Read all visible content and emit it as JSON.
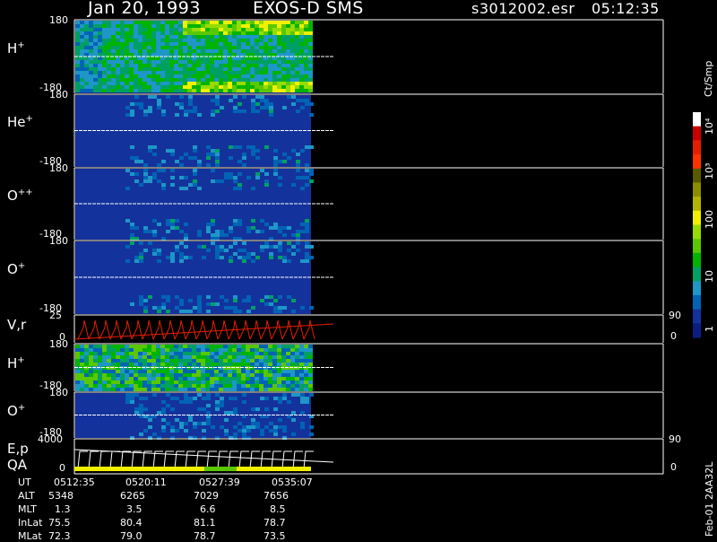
{
  "header": {
    "date": "Jan 20, 1993",
    "instrument": "EXOS-D SMS",
    "file": "s3012002.esr",
    "time": "05:12:35"
  },
  "panels": [
    {
      "id": "h1",
      "label": "H",
      "sup": "+",
      "top": "180",
      "bottom": "-180"
    },
    {
      "id": "he",
      "label": "He",
      "sup": "+",
      "top": "180",
      "bottom": "-180"
    },
    {
      "id": "opp",
      "label": "O",
      "sup": "++",
      "top": "180",
      "bottom": "-180"
    },
    {
      "id": "o1",
      "label": "O",
      "sup": "+",
      "top": "180",
      "bottom": "-180"
    },
    {
      "id": "vr",
      "label": "V,r",
      "sup": "",
      "top": "25",
      "bottom": "0",
      "right_top": "90",
      "right_bottom": "0"
    },
    {
      "id": "h2",
      "label": "H",
      "sup": "+",
      "top": "180",
      "bottom": "-180"
    },
    {
      "id": "o2",
      "label": "O",
      "sup": "+",
      "top": "180",
      "bottom": "-180"
    },
    {
      "id": "ep",
      "label": "E,p",
      "sup": "",
      "label2": "QA",
      "top": "4000",
      "bottom": "0",
      "right_top": "90",
      "right_bottom": "0"
    }
  ],
  "colorbar": {
    "unit": "Ct/Smp",
    "ticks": [
      "10⁴",
      "10³",
      "100",
      "10",
      "1"
    ],
    "colors": [
      "#ffffff",
      "#c80000",
      "#e61e00",
      "#ff3200",
      "#5a5a00",
      "#8c8c00",
      "#b4b400",
      "#f0f000",
      "#96dc00",
      "#5ac800",
      "#00b400",
      "#00a064",
      "#1e96c8",
      "#0064b4",
      "#14329c",
      "#0a1e82"
    ]
  },
  "footer": {
    "rows": [
      {
        "label": "UT",
        "values": [
          "0512:35",
          "0520:11",
          "0527:39",
          "0535:07"
        ]
      },
      {
        "label": "ALT",
        "values": [
          "5348",
          "6265",
          "7029",
          "7656"
        ]
      },
      {
        "label": "MLT",
        "values": [
          "1.3",
          "3.5",
          "6.6",
          "8.5"
        ]
      },
      {
        "label": "InLat",
        "values": [
          "75.5",
          "80.4",
          "81.1",
          "78.7"
        ]
      },
      {
        "label": "MLat",
        "values": [
          "72.3",
          "79.0",
          "78.7",
          "73.5"
        ]
      }
    ],
    "stamp": "Feb-01 2AA32L"
  },
  "chart_data": {
    "type": "heatmap",
    "x_ticks_ut": [
      "0512:35",
      "0520:11",
      "0527:39",
      "0535:07"
    ],
    "panels": [
      "H+",
      "He+",
      "O++",
      "O+",
      "V,r",
      "H+",
      "O+",
      "E,p QA"
    ],
    "ylim": [
      -180,
      180
    ],
    "ylim_vr": [
      0,
      25
    ],
    "ylim_ep": [
      0,
      4000
    ],
    "ylim_right": [
      0,
      90
    ],
    "colorbar_range": [
      1,
      10000
    ],
    "colorbar_unit": "Ct/Smp",
    "qa_bar_colors": [
      "#f0f000",
      "#5ac800",
      "#f0f000"
    ]
  }
}
